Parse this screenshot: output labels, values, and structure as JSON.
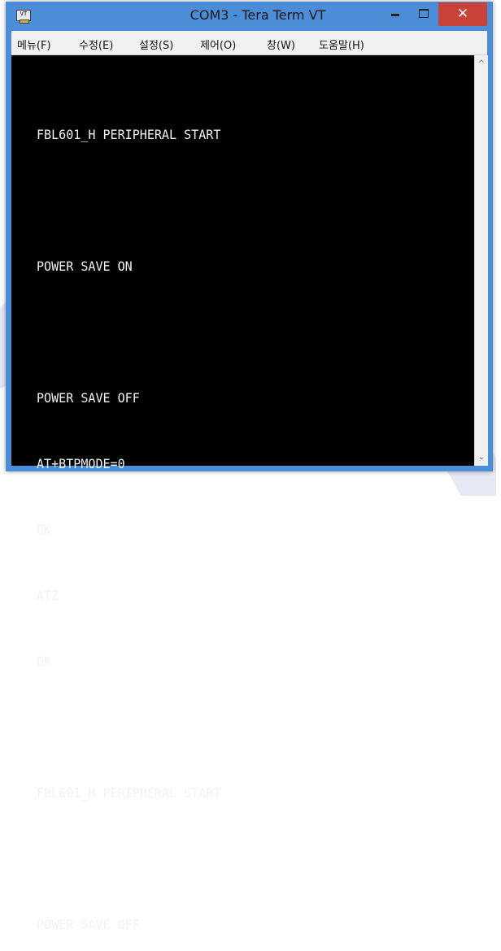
{
  "window": {
    "title": "COM3 - Tera Term VT",
    "icon_label": "VT",
    "controls": {
      "minimize": "minimize",
      "maximize": "maximize",
      "close_glyph": "✕"
    }
  },
  "menu": {
    "items": [
      {
        "label": "메뉴(F)"
      },
      {
        "label": "수정(E)"
      },
      {
        "label": "설정(S)"
      },
      {
        "label": "제어(O)"
      },
      {
        "label": "창(W)"
      },
      {
        "label": "도움말(H)"
      }
    ]
  },
  "terminal": {
    "lines": [
      "FBL601_H PERIPHERAL START",
      "",
      "POWER SAVE ON",
      "",
      "POWER SAVE OFF",
      "AT+BTPMODE=0",
      "OK",
      "ATZ",
      "OK",
      "",
      "FBL601_H PERIPHERAL START",
      "",
      "POWER SAVE OFF"
    ]
  },
  "scrollbar": {
    "up_glyph": "^",
    "down_glyph": "⌄"
  },
  "colors": {
    "title_bar": "#4b8dd6",
    "close_button": "#c9423a",
    "terminal_bg": "#000000",
    "terminal_fg": "#f2f2f2"
  }
}
